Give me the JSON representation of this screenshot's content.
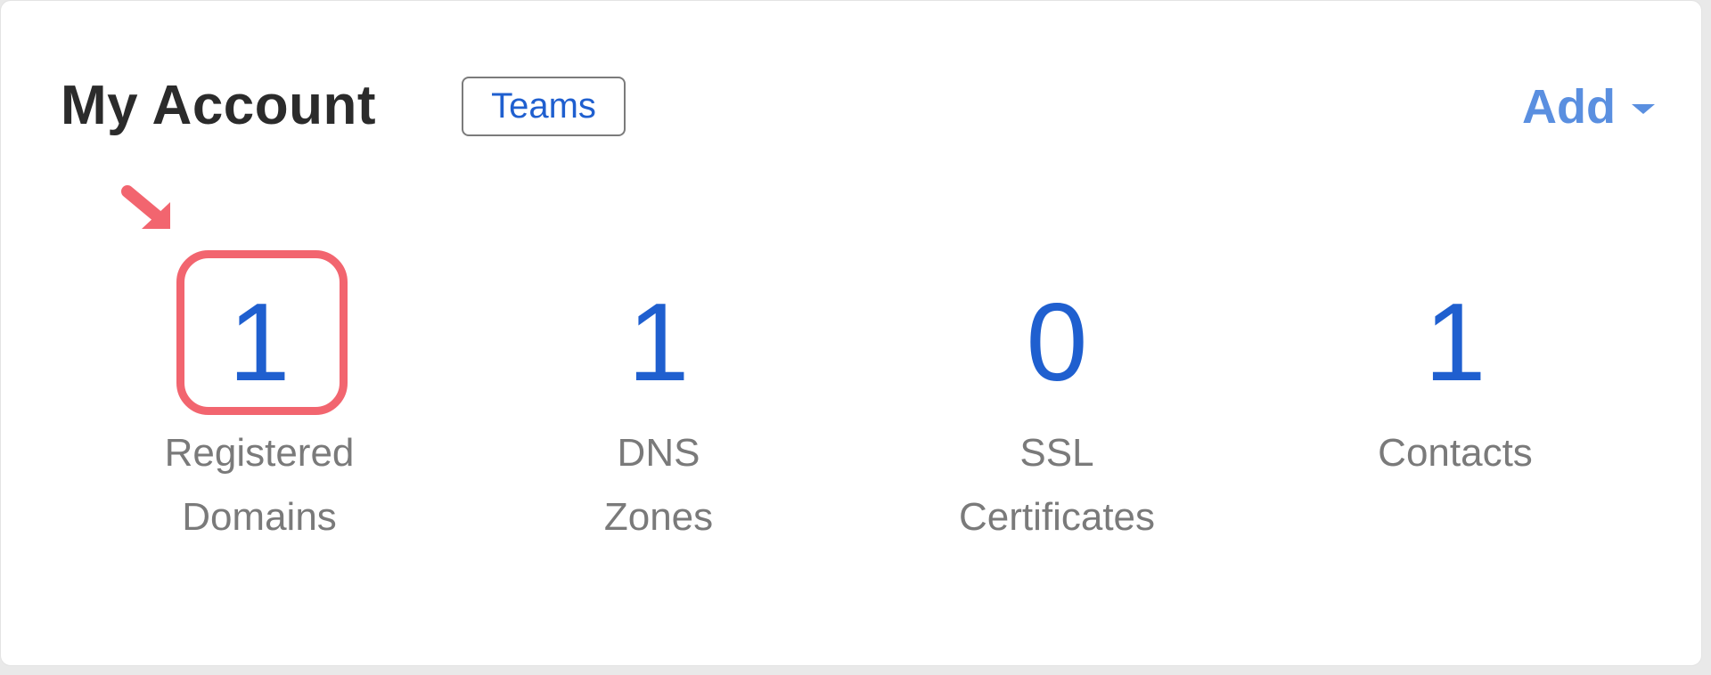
{
  "header": {
    "title": "My Account",
    "teams_label": "Teams",
    "add_label": "Add"
  },
  "stats": [
    {
      "value": "1",
      "label_line1": "Registered",
      "label_line2": "Domains"
    },
    {
      "value": "1",
      "label_line1": "DNS",
      "label_line2": "Zones"
    },
    {
      "value": "0",
      "label_line1": "SSL",
      "label_line2": "Certificates"
    },
    {
      "value": "1",
      "label_line1": "Contacts",
      "label_line2": ""
    }
  ],
  "colors": {
    "accent_blue": "#1f5fcf",
    "add_blue": "#5a8fe0",
    "annotation_red": "#f2656f"
  }
}
